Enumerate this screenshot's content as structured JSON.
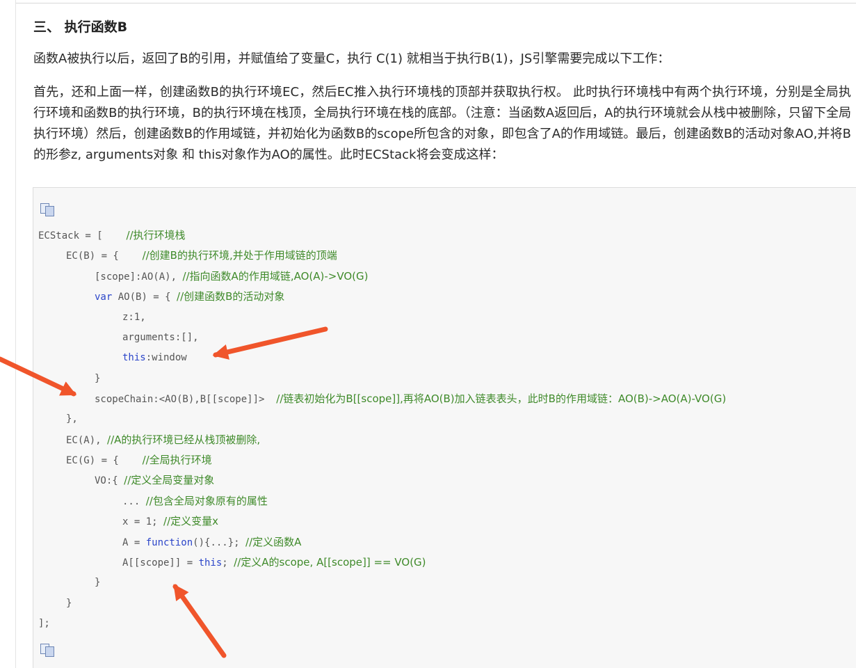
{
  "section": {
    "heading": "三、 执行函数B",
    "para1": "函数A被执行以后，返回了B的引用，并赋值给了变量C，执行 C(1) 就相当于执行B(1)，JS引擎需要完成以下工作：",
    "para2": "首先，还和上面一样，创建函数B的执行环境EC，然后EC推入执行环境栈的顶部并获取执行权。 此时执行环境栈中有两个执行环境，分别是全局执行环境和函数B的执行环境，B的执行环境在栈顶，全局执行环境在栈的底部。（注意：当函数A返回后，A的执行环境就会从栈中被删除，只留下全局执行环境）然后，创建函数B的作用域链，并初始化为函数B的scope所包含的对象，即包含了A的作用域链。最后，创建函数B的活动对象AO,并将B的形参z, arguments对象 和 this对象作为AO的属性。此时ECStack将会变成这样："
  },
  "code": {
    "l1": "ECStack = [",
    "l1c": "//执行环境栈",
    "l2": "EC(B) = {",
    "l2c": "//创建B的执行环境,并处于作用域链的顶端",
    "l3": "[scope]:AO(A),",
    "l3c": "//指向函数A的作用域链,AO(A)->VO(G)",
    "l4kw": "var",
    "l4": " AO(B) = {",
    "l4c": "//创建函数B的活动对象",
    "l5": "z:1,",
    "l6": "arguments:[],",
    "l7kw": "this",
    "l7": ":window",
    "l8": "}",
    "l9": "scopeChain:<AO(B),B[[scope]]>",
    "l9c": "//链表初始化为B[[scope]],再将AO(B)加入链表表头，此时B的作用域链：AO(B)->AO(A)-VO(G)",
    "l10": "},",
    "l11": "EC(A),",
    "l11c": "//A的执行环境已经从栈顶被删除,",
    "l12": "EC(G) = {",
    "l12c": "//全局执行环境",
    "l13": "VO:{",
    "l13c": "//定义全局变量对象",
    "l14": "...",
    "l14c": "//包含全局对象原有的属性",
    "l15": "x = 1;",
    "l15c": "//定义变量x",
    "l16a": "A = ",
    "l16kw": "function",
    "l16b": "(){...};",
    "l16c": "//定义函数A",
    "l17a": "A[[scope]] = ",
    "l17kw": "this",
    "l17b": ";",
    "l17c": "//定义A的scope, A[[scope]] == VO(G)",
    "l18": "}",
    "l19": "}",
    "l20": "];"
  },
  "icons": {
    "copy": "copy-icon",
    "annotation": "arrow-annotation"
  },
  "colors": {
    "comment": "#3f8a2a",
    "keyword": "#2b45c9",
    "arrow": "#f0552b"
  }
}
